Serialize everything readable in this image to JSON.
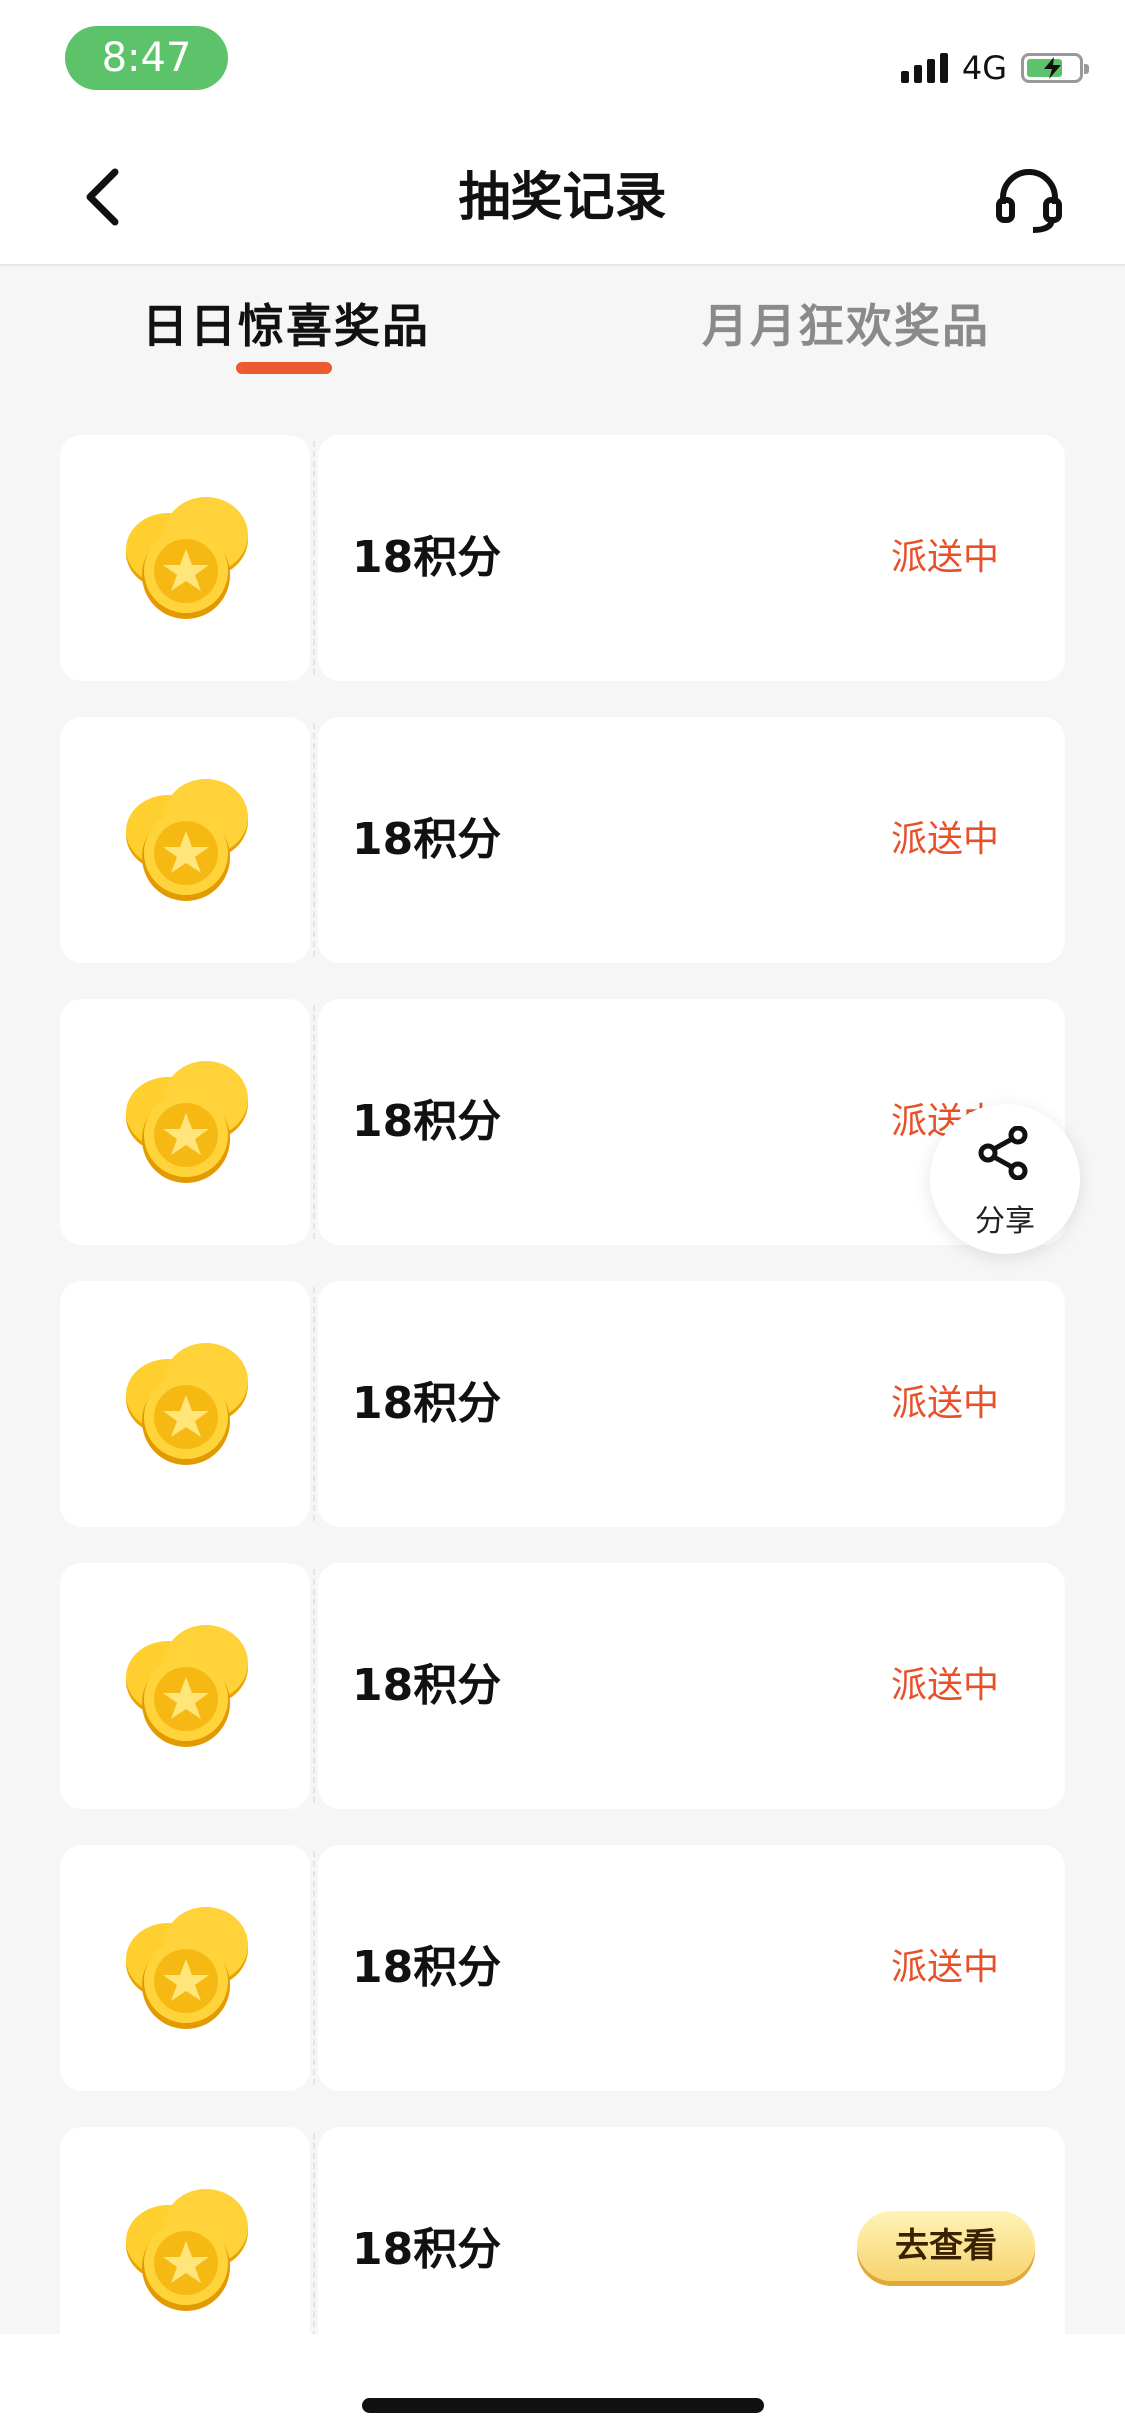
{
  "status_bar": {
    "time": "8:47",
    "network": "4G"
  },
  "nav": {
    "title": "抽奖记录",
    "back_icon": "chevron-left-icon",
    "support_icon": "headset-icon"
  },
  "tabs": [
    {
      "label": "日日惊喜奖品",
      "active": true
    },
    {
      "label": "月月狂欢奖品",
      "active": false
    }
  ],
  "records": [
    {
      "prize": "18积分",
      "status": "派送中"
    },
    {
      "prize": "18积分",
      "status": "派送中"
    },
    {
      "prize": "18积分",
      "status": "派送中"
    },
    {
      "prize": "18积分",
      "status": "派送中"
    },
    {
      "prize": "18积分",
      "status": "派送中"
    },
    {
      "prize": "18积分",
      "status": "派送中"
    },
    {
      "prize": "18积分",
      "action": "去查看"
    }
  ],
  "share": {
    "label": "分享",
    "icon": "share-icon"
  },
  "colors": {
    "accent": "#e8502a",
    "tab_indicator": "#ec5a2d",
    "status_time_bg": "#5cc36a"
  }
}
